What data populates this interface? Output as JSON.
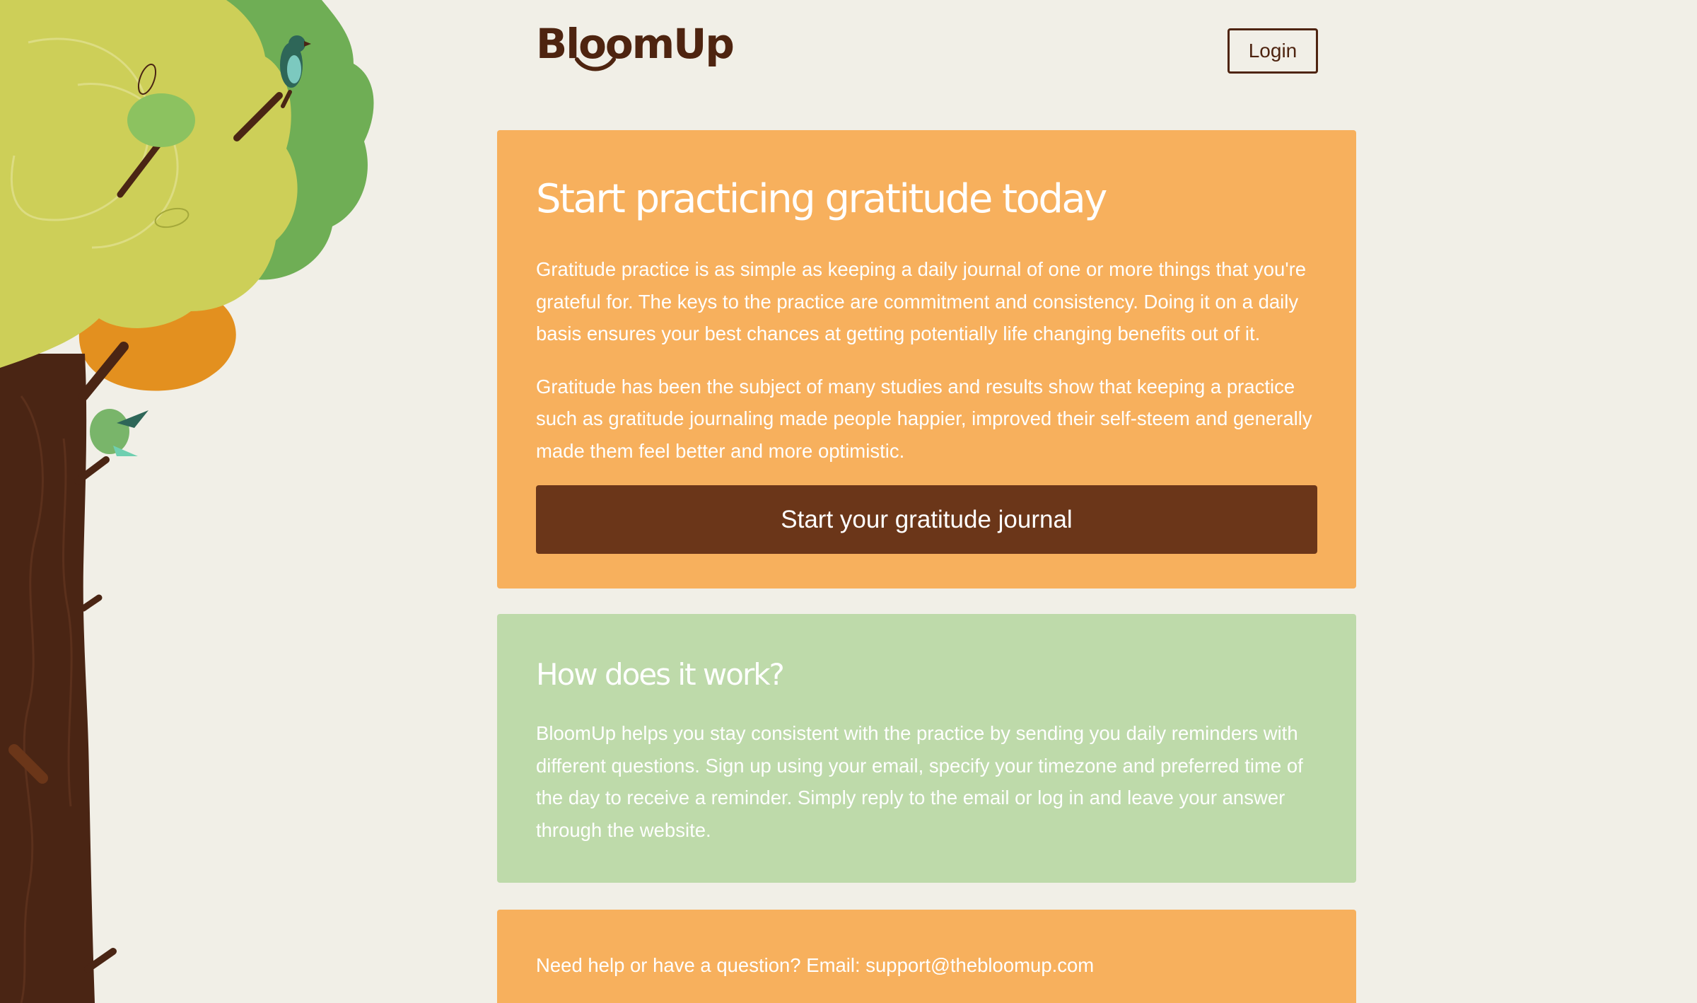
{
  "brand": {
    "name": "BloomUp",
    "colors": {
      "background": "#f1efe7",
      "orange": "#f7b05d",
      "green": "#bedaaa",
      "brown": "#6b3619",
      "logo": "#4e2410"
    }
  },
  "header": {
    "login_label": "Login"
  },
  "hero": {
    "title": "Start practicing gratitude today",
    "paragraph_1": "Gratitude practice is as simple as keeping a daily journal of one or more things that you're grateful for. The keys to the practice are commitment and consistency. Doing it on a daily basis ensures your best chances at getting potentially life changing benefits out of it.",
    "paragraph_2": "Gratitude has been the subject of many studies and results show that keeping a practice such as gratitude journaling made people happier, improved their self-steem and generally made them feel better and more optimistic.",
    "cta_label": "Start your gratitude journal"
  },
  "how": {
    "title": "How does it work?",
    "paragraph": "BloomUp helps you stay consistent with the practice by sending you daily reminders with different questions. Sign up using your email, specify your timezone and preferred time of the day to receive a reminder. Simply reply to the email or log in and leave your answer through the website."
  },
  "help": {
    "prefix": "Need help or have a question? Email: ",
    "email": "support@thebloomup.com"
  }
}
